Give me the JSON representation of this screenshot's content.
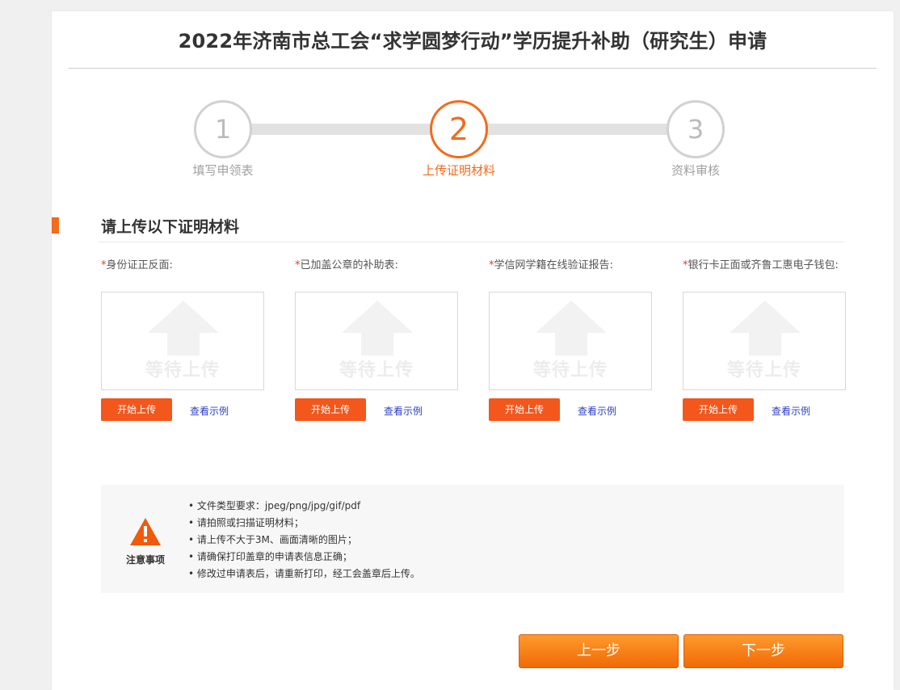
{
  "page": {
    "title": "2022年济南市总工会“求学圆梦行动”学历提升补助（研究生）申请"
  },
  "steps": [
    {
      "number": "1",
      "label": "填写申领表",
      "active": false
    },
    {
      "number": "2",
      "label": "上传证明材料",
      "active": true
    },
    {
      "number": "3",
      "label": "资料审核",
      "active": false
    }
  ],
  "section": {
    "title": "请上传以下证明材料"
  },
  "uploads": [
    {
      "required_mark": "*",
      "label": "身份证正反面:",
      "placeholder": "等待上传",
      "upload_button": "开始上传",
      "example_link": "查看示例"
    },
    {
      "required_mark": "*",
      "label": "已加盖公章的补助表:",
      "placeholder": "等待上传",
      "upload_button": "开始上传",
      "example_link": "查看示例"
    },
    {
      "required_mark": "*",
      "label": "学信网学籍在线验证报告:",
      "placeholder": "等待上传",
      "upload_button": "开始上传",
      "example_link": "查看示例"
    },
    {
      "required_mark": "*",
      "label": "银行卡正面或齐鲁工惠电子钱包:",
      "placeholder": "等待上传",
      "upload_button": "开始上传",
      "example_link": "查看示例"
    }
  ],
  "notice": {
    "icon": "warning-icon",
    "label": "注意事项",
    "items": [
      "文件类型要求：jpeg/png/jpg/gif/pdf",
      "请拍照或扫描证明材料；",
      "请上传不大于3M、画面清晰的图片；",
      "请确保打印盖章的申请表信息正确；",
      "修改过申请表后，请重新打印，经工会盖章后上传。"
    ]
  },
  "navigation": {
    "prev_label": "上一步",
    "next_label": "下一步"
  },
  "colors": {
    "accent": "#f36b1c",
    "button": "#f3571c",
    "link": "#2a3cc4",
    "required": "#e63c1e"
  }
}
